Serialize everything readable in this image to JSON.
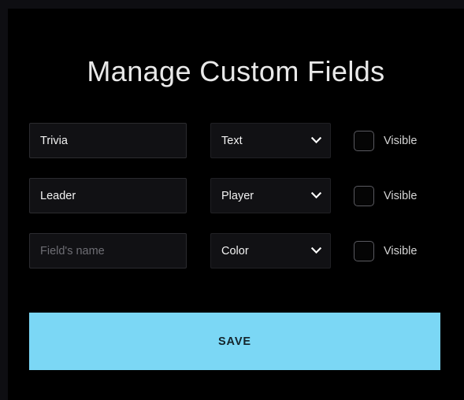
{
  "page": {
    "title": "Manage Custom Fields",
    "accent_color": "#7bd7f5",
    "background_color": "#000000"
  },
  "fields": [
    {
      "name_value": "Trivia",
      "name_placeholder": "Field's name",
      "type_value": "Text",
      "visible_label": "Visible",
      "visible_checked": false
    },
    {
      "name_value": "Leader",
      "name_placeholder": "Field's name",
      "type_value": "Player",
      "visible_label": "Visible",
      "visible_checked": false
    },
    {
      "name_value": "",
      "name_placeholder": "Field's name",
      "type_value": "Color",
      "visible_label": "Visible",
      "visible_checked": false
    }
  ],
  "icons": {
    "chevron": "chevron-down-icon"
  },
  "save": {
    "label": "SAVE"
  }
}
